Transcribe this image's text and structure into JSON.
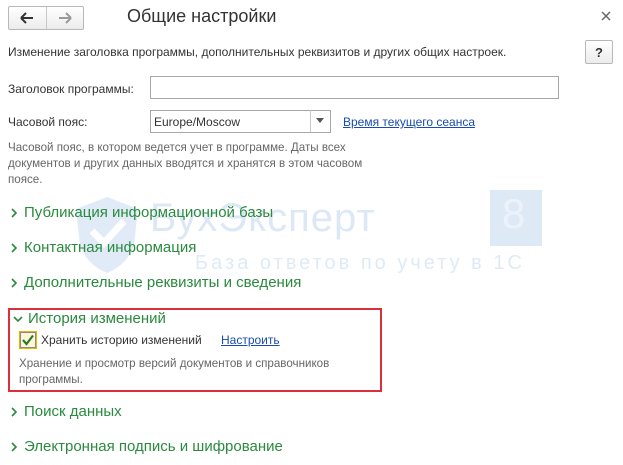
{
  "window": {
    "title": "Общие настройки",
    "description": "Изменение заголовка программы, дополнительных реквизитов и других общих настроек.",
    "help_label": "?"
  },
  "fields": {
    "program_title_label": "Заголовок программы:",
    "program_title_value": "",
    "timezone_label": "Часовой пояс:",
    "timezone_value": "Europe/Moscow",
    "session_time_link": "Время текущего сеанса",
    "timezone_hint": "Часовой пояс, в котором ведется учет в программе. Даты всех документов и других данных вводятся и хранятся в этом часовом поясе."
  },
  "sections": [
    {
      "label": "Публикация информационной базы",
      "expanded": false
    },
    {
      "label": "Контактная информация",
      "expanded": false
    },
    {
      "label": "Дополнительные реквизиты и сведения",
      "expanded": false
    },
    {
      "label": "История изменений",
      "expanded": true
    },
    {
      "label": "Поиск данных",
      "expanded": false
    },
    {
      "label": "Электронная подпись и шифрование",
      "expanded": false
    }
  ],
  "history": {
    "checkbox_label": "Хранить историю изменений",
    "checked": true,
    "configure_link": "Настроить",
    "hint": "Хранение и просмотр версий документов и справочников программы."
  },
  "watermark": {
    "brand": "БухЭксперт",
    "number": "8",
    "tagline": "База ответов по учету в 1С"
  },
  "colors": {
    "section_green": "#2a8a3e",
    "link_blue": "#1a4bb0",
    "highlight_red": "#d9303a",
    "watermark_blue": "#2f76c8"
  }
}
